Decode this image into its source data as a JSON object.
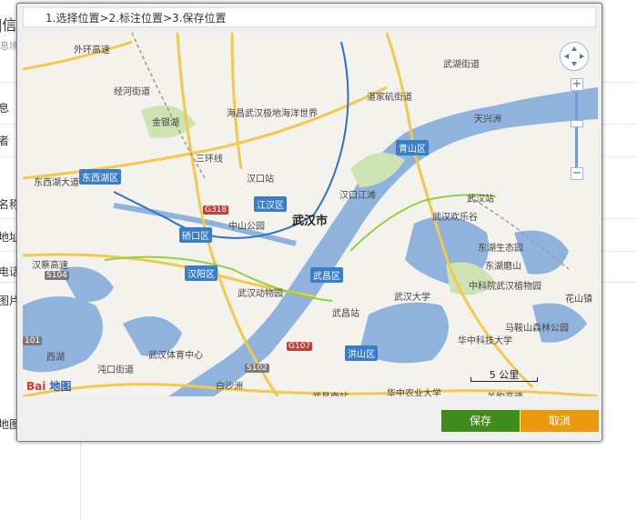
{
  "background": {
    "title_fragment": "]信",
    "subtitle_fragment": "息境",
    "labels": [
      "息",
      "者",
      "名称",
      "地址",
      "电话",
      "图片",
      "地图"
    ]
  },
  "dialog": {
    "steps": "1.选择位置>2.标注位置>3.保存位置",
    "save_label": "保存",
    "cancel_label": "取消"
  },
  "map": {
    "city_label": "武汉市",
    "scale_label": "5 公里",
    "logo_bai": "Bai",
    "logo_du": "地图",
    "districts": [
      "东西湖区",
      "江汉区",
      "硚口区",
      "汉阳区",
      "武昌区",
      "青山区",
      "洪山区"
    ],
    "places": [
      "外环高速",
      "东西湖大道",
      "汉蔡高速",
      "三环线",
      "汉口站",
      "中山公园",
      "武汉站",
      "武昌站",
      "武汉动物园",
      "武汉体育中心",
      "华中农业大学",
      "武昌南站",
      "东湖生态园",
      "马鞍山森林公园",
      "华中科技大学",
      "武汉大学",
      "武汉欢乐谷",
      "汉口江滩",
      "湛家矶街道",
      "武湖街道",
      "天兴洲",
      "白沙洲",
      "海昌武汉极地海洋世界",
      "关豹高速",
      "花山镇",
      "沌口街道",
      "经河街道",
      "金银湖",
      "西湖",
      "中科院武汉植物园",
      "东湖磨山"
    ],
    "road_tags": [
      "G318",
      "S104",
      "G107",
      "S102",
      "101"
    ]
  },
  "colors": {
    "save": "#3f8c1b",
    "cancel": "#e89a0b",
    "water": "#8fb3dd",
    "district_badge": "#3a7dc9"
  }
}
